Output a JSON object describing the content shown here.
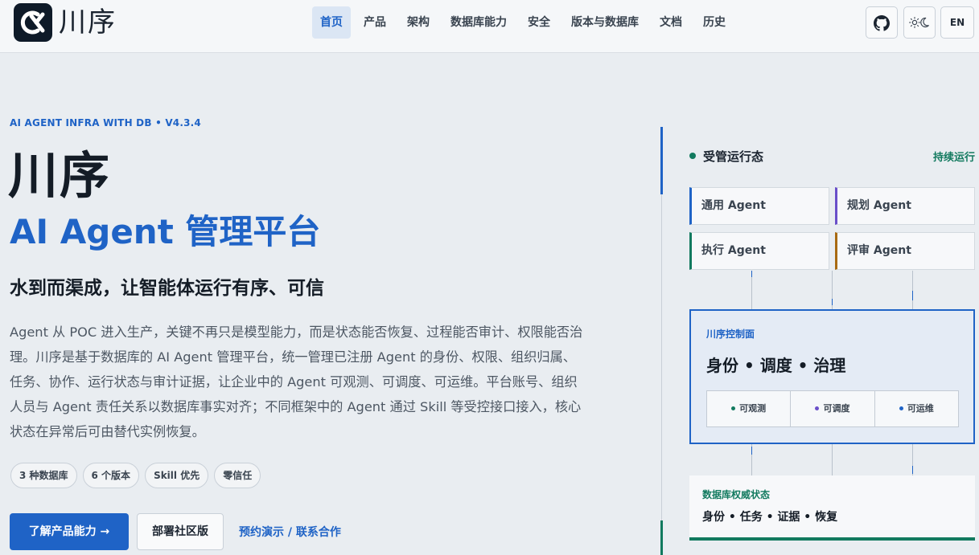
{
  "brand": {
    "name": "川序"
  },
  "nav": {
    "items": [
      "首页",
      "产品",
      "架构",
      "数据库能力",
      "安全",
      "版本与数据库",
      "文档",
      "历史"
    ],
    "active_index": 0
  },
  "header_actions": {
    "lang_label": "EN"
  },
  "hero": {
    "eyebrow": "AI AGENT INFRA WITH DB  •  V4.3.4",
    "title": "川序",
    "subtitle": "AI Agent 管理平台",
    "tagline": "水到而渠成，让智能体运行有序、可信",
    "description": "Agent 从 POC 进入生产，关键不再只是模型能力，而是状态能否恢复、过程能否审计、权限能否治理。川序是基于数据库的 AI Agent 管理平台，统一管理已注册 Agent 的身份、权限、组织归属、任务、协作、运行状态与审计证据，让企业中的 Agent 可观测、可调度、可运维。平台账号、组织人员与 Agent 责任关系以数据库事实对齐；不同框架中的 Agent 通过 Skill 等受控接口接入，核心状态在异常后可由替代实例恢复。",
    "pills": [
      "3 种数据库",
      "6 个版本",
      "Skill 优先",
      "零信任"
    ],
    "cta_primary": "了解产品能力 →",
    "cta_secondary": "部署社区版",
    "cta_link": "预约演示 / 联系合作"
  },
  "panel": {
    "status_title": "受管运行态",
    "status_right": "持续运行",
    "agents": [
      {
        "label": "通用 Agent",
        "color": "#1f63c6"
      },
      {
        "label": "规划 Agent",
        "color": "#6a4fc9"
      },
      {
        "label": "执行 Agent",
        "color": "#127a5f"
      },
      {
        "label": "评审 Agent",
        "color": "#a86a12"
      }
    ],
    "control": {
      "label": "川序控制面",
      "title": "身份  •  调度  •  治理",
      "caps": [
        {
          "label": "可观测",
          "color": "#127a5f"
        },
        {
          "label": "可调度",
          "color": "#6a4fc9"
        },
        {
          "label": "可运维",
          "color": "#1f63c6"
        }
      ]
    },
    "db": {
      "label": "数据库权威状态",
      "title": "身份  •  任务  •  证据  •  恢复"
    }
  },
  "colors": {
    "accent": "#1f63c6",
    "green": "#127a5f",
    "purple": "#6a4fc9",
    "amber": "#a86a12"
  }
}
